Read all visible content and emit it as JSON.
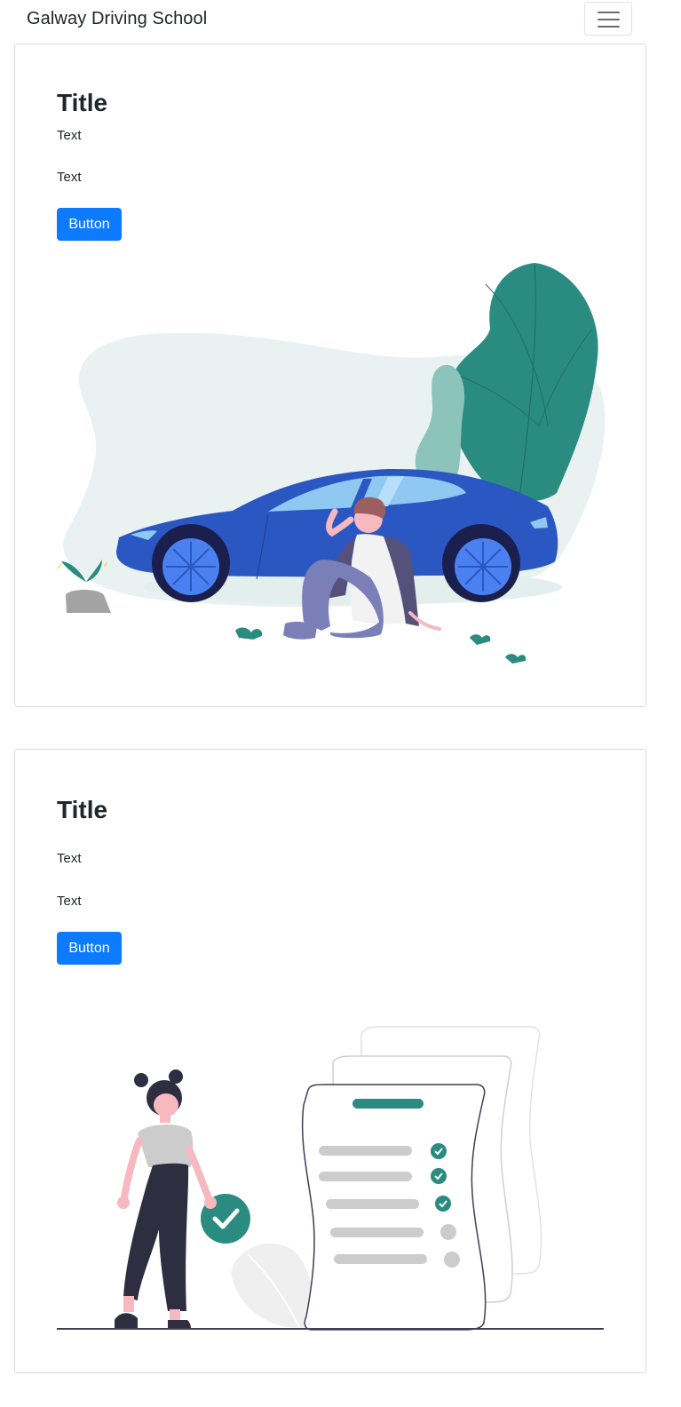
{
  "navbar": {
    "brand": "Galway Driving School"
  },
  "cards": [
    {
      "title": "Title",
      "text1": "Text",
      "text2": "Text",
      "button": "Button"
    },
    {
      "title": "Title",
      "text1": "Text",
      "text2": "Text",
      "button": "Button"
    }
  ],
  "colors": {
    "primary": "#0d7bff",
    "accent_teal": "#2a8c80",
    "car_blue": "#2b57c2",
    "wheel_blue": "#4a80f0",
    "text": "#212529"
  }
}
